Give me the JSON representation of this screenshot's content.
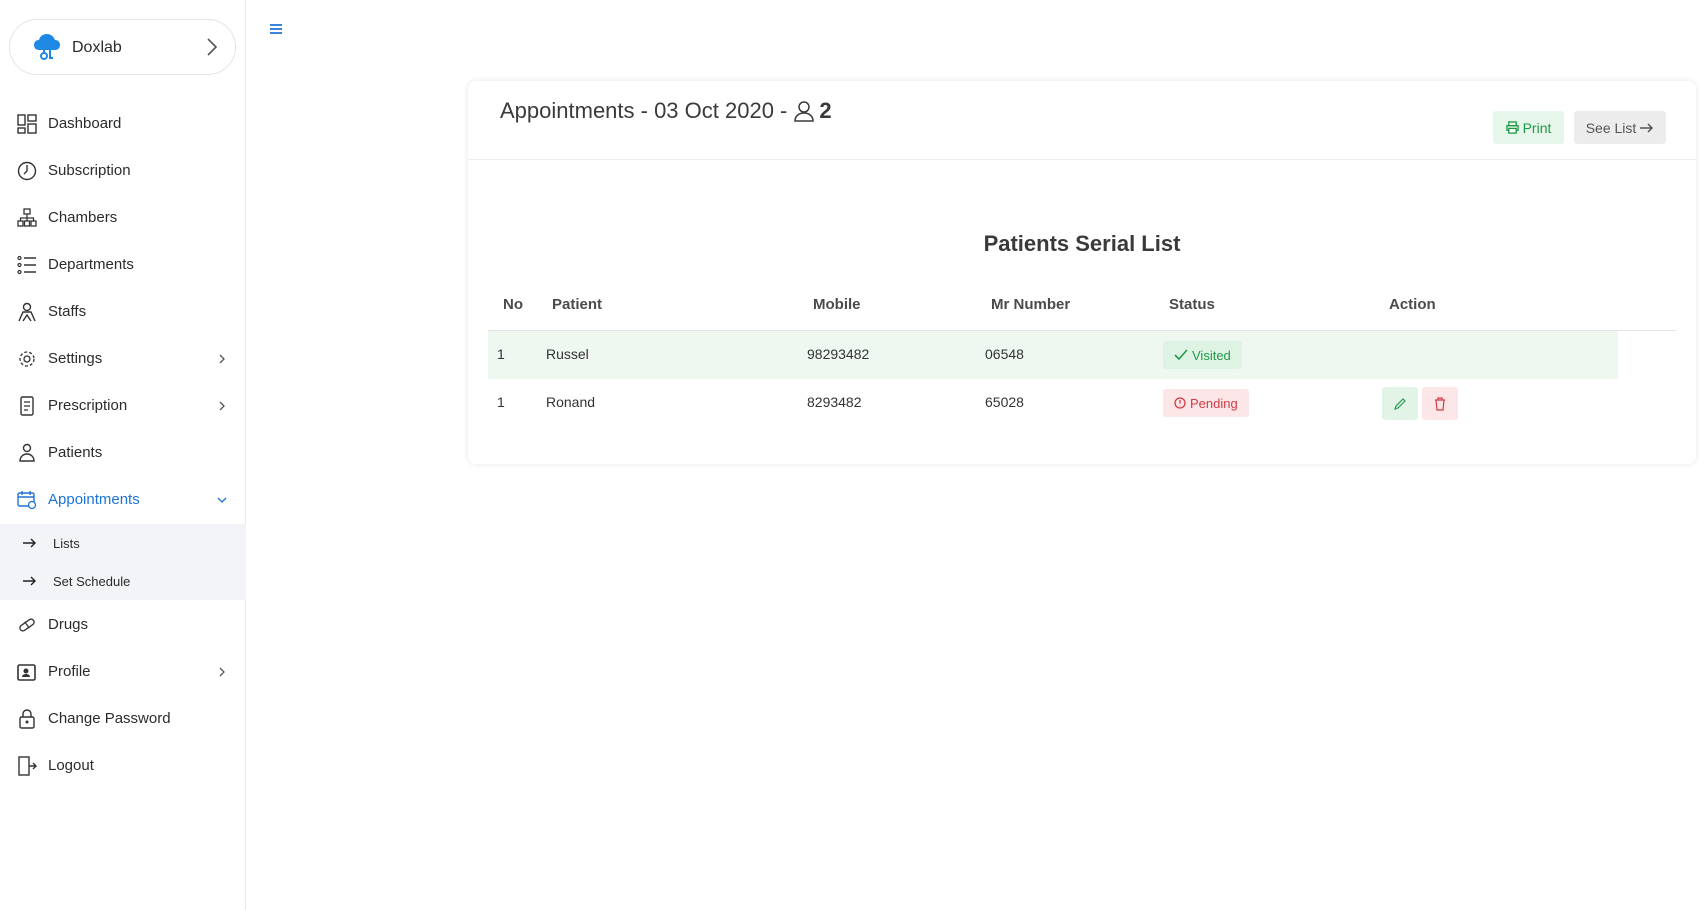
{
  "brand": {
    "name": "Doxlab"
  },
  "sidebar": {
    "items": [
      {
        "label": "Dashboard",
        "icon": "dashboard-icon"
      },
      {
        "label": "Subscription",
        "icon": "clock-icon"
      },
      {
        "label": "Chambers",
        "icon": "sitemap-icon"
      },
      {
        "label": "Departments",
        "icon": "list-icon"
      },
      {
        "label": "Staffs",
        "icon": "staff-icon"
      },
      {
        "label": "Settings",
        "icon": "gear-icon"
      },
      {
        "label": "Prescription",
        "icon": "prescription-icon"
      },
      {
        "label": "Patients",
        "icon": "patients-icon"
      },
      {
        "label": "Appointments",
        "icon": "appointment-icon"
      },
      {
        "label": "Drugs",
        "icon": "pill-icon"
      },
      {
        "label": "Profile",
        "icon": "profile-icon"
      },
      {
        "label": "Change Password",
        "icon": "lock-icon"
      },
      {
        "label": "Logout",
        "icon": "logout-icon"
      }
    ],
    "submenu": [
      {
        "label": "Lists"
      },
      {
        "label": "Set Schedule"
      }
    ],
    "active_color": "#1e74d6"
  },
  "card": {
    "title": "Appointments - 03 Oct 2020 -",
    "count": "2",
    "print_label": "Print",
    "see_list_label": "See List"
  },
  "table": {
    "title": "Patients Serial List",
    "headers": {
      "no": "No",
      "patient": "Patient",
      "mobile": "Mobile",
      "mr": "Mr Number",
      "status": "Status",
      "action": "Action"
    },
    "rows": [
      {
        "no": "1",
        "patient": "Russel",
        "mobile": "98293482",
        "mr": "06548",
        "status": "Visited"
      },
      {
        "no": "1",
        "patient": "Ronand",
        "mobile": "8293482",
        "mr": "65028",
        "status": "Pending"
      }
    ]
  }
}
